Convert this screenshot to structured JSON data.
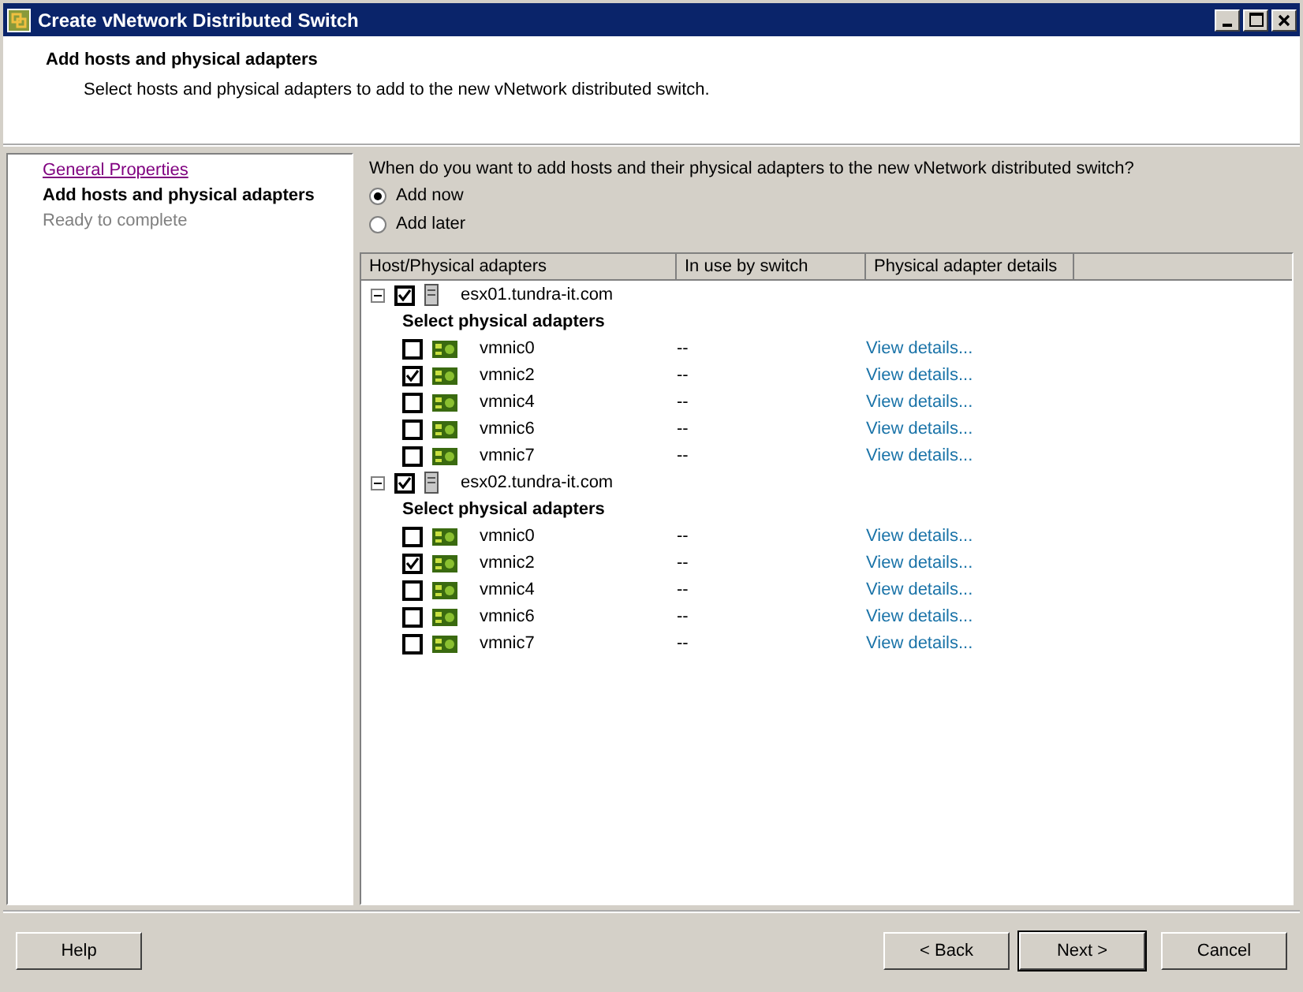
{
  "window": {
    "title": "Create vNetwork Distributed Switch"
  },
  "header": {
    "title": "Add hosts and physical adapters",
    "subtitle": "Select hosts and physical adapters to add to the new vNetwork distributed switch."
  },
  "steps": [
    {
      "label": "General Properties",
      "kind": "link"
    },
    {
      "label": "Add hosts and physical adapters",
      "kind": "current"
    },
    {
      "label": "Ready to complete",
      "kind": "pending"
    }
  ],
  "question": "When do you want to add hosts and their physical adapters to the new vNetwork distributed switch?",
  "options": [
    {
      "label": "Add now",
      "selected": true
    },
    {
      "label": "Add later",
      "selected": false
    }
  ],
  "table": {
    "columns": [
      "Host/Physical adapters",
      "In use by switch",
      "Physical adapter details"
    ],
    "hosts": [
      {
        "name": "esx01.tundra-it.com",
        "checked": true,
        "expanded": true,
        "group_label": "Select physical adapters",
        "children": [
          {
            "name": "vmnic0",
            "checked": false,
            "in_use": "--",
            "details": "View details..."
          },
          {
            "name": "vmnic2",
            "checked": true,
            "in_use": "--",
            "details": "View details..."
          },
          {
            "name": "vmnic4",
            "checked": false,
            "in_use": "--",
            "details": "View details..."
          },
          {
            "name": "vmnic6",
            "checked": false,
            "in_use": "--",
            "details": "View details..."
          },
          {
            "name": "vmnic7",
            "checked": false,
            "in_use": "--",
            "details": "View details..."
          }
        ]
      },
      {
        "name": "esx02.tundra-it.com",
        "checked": true,
        "expanded": true,
        "group_label": "Select physical adapters",
        "children": [
          {
            "name": "vmnic0",
            "checked": false,
            "in_use": "--",
            "details": "View details..."
          },
          {
            "name": "vmnic2",
            "checked": true,
            "in_use": "--",
            "details": "View details..."
          },
          {
            "name": "vmnic4",
            "checked": false,
            "in_use": "--",
            "details": "View details..."
          },
          {
            "name": "vmnic6",
            "checked": false,
            "in_use": "--",
            "details": "View details..."
          },
          {
            "name": "vmnic7",
            "checked": false,
            "in_use": "--",
            "details": "View details..."
          }
        ]
      }
    ]
  },
  "buttons": {
    "help": "Help",
    "back": "< Back",
    "next": "Next >",
    "cancel": "Cancel"
  }
}
